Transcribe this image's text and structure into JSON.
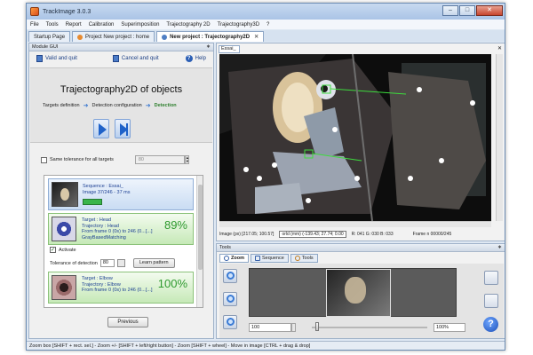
{
  "window": {
    "title": "TrackImage 3.0.3"
  },
  "menu": [
    "File",
    "Tools",
    "Report",
    "Calibration",
    "Superimposition",
    "Trajectography 2D",
    "Trajectography3D",
    "?"
  ],
  "doc_tabs": [
    {
      "label": "Startup Page"
    },
    {
      "label": "Project New project : home"
    },
    {
      "label": "New project : Trajectography2D"
    }
  ],
  "module": {
    "header": "Module GUI",
    "valid_label": "Valid and quit",
    "cancel_label": "Cancel and quit",
    "help_label": "Help",
    "title": "Trajectography2D of objects",
    "steps": [
      "Targets definition",
      "Detection configuration",
      "Detection"
    ],
    "same_tolerance_label": "Same tolerance for all targets",
    "same_tolerance_value": "80",
    "sequence": {
      "line1": "Sequence : Essai_",
      "line2": "Image 37/246 - 37 ms"
    },
    "targets": [
      {
        "name": "Target : Head",
        "trajectory": "Trajectory : Head",
        "frames": "From frame 0 (0s) to 246 (0...[...]",
        "method": "GrayBasedMatching",
        "percent": "89%",
        "icon": "head-target-icon"
      },
      {
        "name": "Target : Elbow",
        "trajectory": "Trajectory : Elbow",
        "frames": "From frame 0 (0s) to 246 (0...[...]",
        "percent": "100%",
        "icon": "elbow-target-icon"
      }
    ],
    "activate_label": "Activate",
    "tolerance_label": "Tolerance of detection",
    "tolerance_value": "80",
    "learn_label": "Learn pattern",
    "previous_label": "Previous"
  },
  "viewer": {
    "tab": "Essai_",
    "image_coords": "Image (px) [217.05; 100.57]",
    "world_coords": "orld (mm) (-139.43; 27.74; 0.00",
    "rgb": "R: 041 G: 030 B: 033",
    "frame": "Frame n 00000/245"
  },
  "tools": {
    "header": "Tools",
    "tabs": [
      "Zoom",
      "Sequence",
      "Tools"
    ],
    "zoom_value": "100",
    "zoom_percent": "100%"
  },
  "status_bar": "Zoom box [SHIFT + rect. sel.] - Zoom +/- [SHIFT + left/right button] - Zoom [SHIFT + wheel] - Move in image [CTRL + drag & drop]"
}
